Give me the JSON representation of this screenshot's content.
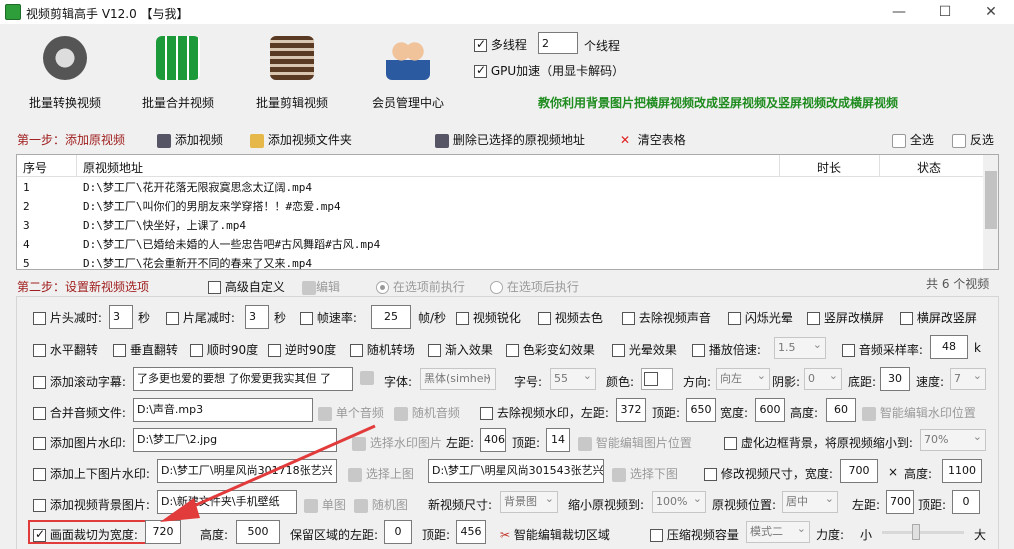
{
  "window": {
    "title": "视频剪辑高手 V12.0  【与我】"
  },
  "toolbar": {
    "batch_convert": "批量转换视频",
    "batch_merge": "批量合并视频",
    "batch_clip": "批量剪辑视频",
    "member": "会员管理中心"
  },
  "settings": {
    "multithread_label": "多线程",
    "thread_count": "2",
    "thread_suffix": "个线程",
    "gpu_label": "GPU加速（用显卡解码）"
  },
  "promo": "教你利用背景图片把横屏视频改成竖屏视频及竖屏视频改成横屏视频",
  "step1": {
    "label": "第一步：添加原视频",
    "add_video": "添加视频",
    "add_folder": "添加视频文件夹",
    "delete_selected": "删除已选择的原视频地址",
    "clear_table": "清空表格",
    "select_all": "全选",
    "invert": "反选"
  },
  "table": {
    "columns": [
      "序号",
      "原视频地址",
      "时长",
      "状态"
    ],
    "rows": [
      {
        "no": "1",
        "path": "D:\\梦工厂\\花开花落无限寂寞思念太辽阔.mp4"
      },
      {
        "no": "2",
        "path": "D:\\梦工厂\\叫你们的男朋友来学穿搭！！#恋爱.mp4"
      },
      {
        "no": "3",
        "path": "D:\\梦工厂\\快坐好，上课了.mp4"
      },
      {
        "no": "4",
        "path": "D:\\梦工厂\\已婚给未婚的人一些忠告吧#古风舞蹈#古风.mp4"
      },
      {
        "no": "5",
        "path": "D:\\梦工厂\\花会重新开不同的春来了又来.mp4"
      }
    ]
  },
  "step2": {
    "label": "第二步：设置新视频选项",
    "advanced": "高级自定义",
    "edit": "编辑",
    "before_exec": "在选项前执行",
    "after_exec": "在选项后执行",
    "count": "共 6 个视频"
  },
  "opts": {
    "head_cut": "片头减时:",
    "head_cut_val": "3",
    "sec1": "秒",
    "tail_cut": "片尾减时:",
    "tail_cut_val": "3",
    "sec2": "秒",
    "fps": "帧速率:",
    "fps_val": "25",
    "fps_unit": "帧/秒",
    "sharpen": "视频锐化",
    "decolor": "视频去色",
    "remove_audio": "去除视频声音",
    "flash": "闪烁光晕",
    "v2h": "竖屏改横屏",
    "h2v": "横屏改竖屏",
    "hflip": "水平翻转",
    "vflip": "垂直翻转",
    "cw90": "顺时90度",
    "ccw90": "逆时90度",
    "random_trans": "随机转场",
    "fade_in": "渐入效果",
    "color_fx": "色彩变幻效果",
    "halo": "光晕效果",
    "speed": "播放倍速:",
    "speed_val": "1.5",
    "samplerate": "音频采样率:",
    "samplerate_val": "48",
    "samplerate_unit": "k",
    "scroll_sub": "添加滚动字幕:",
    "scroll_text": "了多更也爱的要想 了你爱更我实其但 了",
    "font": "字体:",
    "font_val": "黑体(simhei)",
    "fontsize": "字号:",
    "fontsize_val": "55",
    "color": "颜色:",
    "direction": "方向:",
    "direction_val": "向左",
    "shadow": "阴影:",
    "shadow_val": "0",
    "bottom": "底距:",
    "bottom_val": "30",
    "speed2": "速度:",
    "speed2_val": "7",
    "merge_audio": "合并音频文件:",
    "audio_path": "D:\\声音.mp3",
    "single_audio": "单个音频",
    "random_audio": "随机音频",
    "remove_wm": "去除视频水印，左距:",
    "wm_left": "372",
    "wm_top_l": "顶距:",
    "wm_top": "650",
    "wm_w_l": "宽度:",
    "wm_w": "600",
    "wm_h_l": "高度:",
    "wm_h": "60",
    "smart_wm": "智能编辑水印位置",
    "img_wm": "添加图片水印:",
    "img_wm_path": "D:\\梦工厂\\2.jpg",
    "sel_wm_img": "选择水印图片",
    "img_left_l": "左距:",
    "img_left": "406",
    "img_top_l": "顶距:",
    "img_top": "14",
    "smart_img": "智能编辑图片位置",
    "blur_bg": "虚化边框背景，将原视频缩小到:",
    "blur_val": "70%",
    "tb_wm": "添加上下图片水印:",
    "top_img": "D:\\梦工厂\\明星风尚301718张艺兴",
    "sel_top": "选择上图",
    "bot_img": "D:\\梦工厂\\明星风尚301543张艺兴",
    "sel_bot": "选择下图",
    "resize": "修改视频尺寸，宽度:",
    "resize_w": "700",
    "times": "×",
    "resize_h_l": "高度:",
    "resize_h": "1100",
    "bg_img": "添加视频背景图片:",
    "bg_path": "D:\\新建文件夹\\手机壁纸",
    "single_img": "单图",
    "random_img": "随机图",
    "new_size": "新视频尺寸:",
    "new_size_val": "背景图",
    "shrink": "缩小原视频到:",
    "shrink_val": "100%",
    "pos": "原视频位置:",
    "pos_val": "居中",
    "pos_left_l": "左距:",
    "pos_left": "700",
    "pos_top_l": "顶距:",
    "pos_top": "0",
    "crop": "画面裁切为宽度:",
    "crop_w": "720",
    "crop_h_l": "高度:",
    "crop_h": "500",
    "keep_left": "保留区域的左距:",
    "keep_left_val": "0",
    "keep_top_l": "顶距:",
    "keep_top": "456",
    "smart_crop": "智能编辑裁切区域",
    "compress": "压缩视频容量",
    "mode_val": "模式二",
    "strength": "力度:",
    "small": "小",
    "big": "大"
  },
  "colors": {
    "promo": "#1f8c1f",
    "step": "#a02020",
    "arrow": "#e23b3b"
  }
}
